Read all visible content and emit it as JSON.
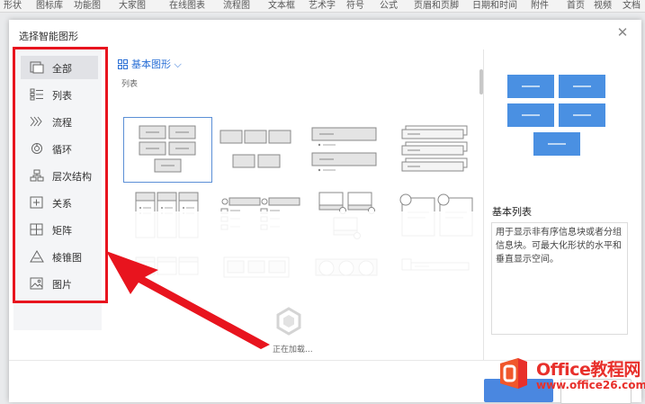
{
  "ribbon": {
    "items": [
      "形状",
      "图标库",
      "功能图",
      "大家图",
      "在线图表",
      "流程图",
      "文本框",
      "艺术字",
      "符号",
      "公式",
      "页眉和页脚",
      "日期和时间",
      "附件",
      "首页",
      "视频",
      "文档"
    ]
  },
  "dialog": {
    "title": "选择智能图形"
  },
  "sidebar": {
    "items": [
      {
        "label": "全部",
        "icon": "all-icon"
      },
      {
        "label": "列表",
        "icon": "list-icon"
      },
      {
        "label": "流程",
        "icon": "process-icon"
      },
      {
        "label": "循环",
        "icon": "cycle-icon"
      },
      {
        "label": "层次结构",
        "icon": "hierarchy-icon"
      },
      {
        "label": "关系",
        "icon": "relationship-icon"
      },
      {
        "label": "矩阵",
        "icon": "matrix-icon"
      },
      {
        "label": "棱锥图",
        "icon": "pyramid-icon"
      },
      {
        "label": "图片",
        "icon": "picture-icon"
      }
    ]
  },
  "main": {
    "category_dropdown": "基本图形",
    "section_label": "列表",
    "loading_text": "正在加载..."
  },
  "preview": {
    "title": "基本列表",
    "description": "用于显示非有序信息块或者分组信息块。可最大化形状的水平和垂直显示空间。"
  },
  "watermark": {
    "brand": "Office教程网",
    "url": "www.office26.com"
  },
  "colors": {
    "accent": "#4a87e0",
    "preview_block": "#4a90e2",
    "highlight": "#e8141e"
  }
}
